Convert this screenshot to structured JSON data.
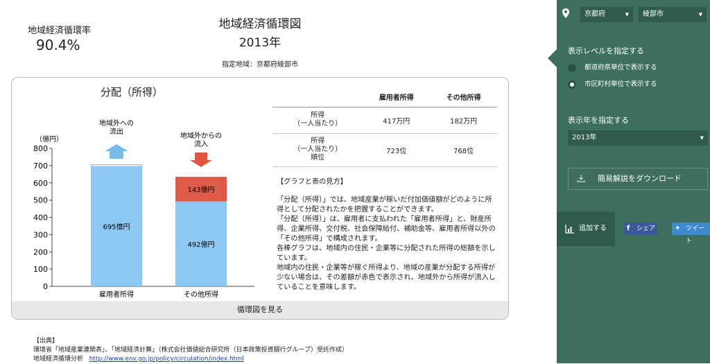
{
  "page": {
    "circulation_rate_label": "地域経済循環率",
    "circulation_rate_value": "90.4%",
    "title": "地域経済循環図",
    "year": "2013年",
    "region_label": "指定地域：京都府綾部市"
  },
  "card": {
    "chart_title": "分配（所得）",
    "footer_button": "循環図を見る"
  },
  "chart_data": {
    "type": "bar",
    "ylabel": "（億円）",
    "ylim": [
      0,
      800
    ],
    "yticks": [
      0,
      100,
      200,
      300,
      400,
      500,
      600,
      700,
      800
    ],
    "categories": [
      "雇用者所得",
      "その他所得"
    ],
    "series": [
      {
        "name": "",
        "values": [
          695,
          492
        ],
        "labels": [
          "695億円",
          "492億円"
        ],
        "color": "#8dc8f5"
      },
      {
        "name": "",
        "values": [
          0,
          143
        ],
        "labels": [
          "",
          "143億円"
        ],
        "color": "#de5b49"
      }
    ],
    "outflow_cap": 705,
    "annotations": {
      "outflow": [
        "地域外への",
        "流出"
      ],
      "inflow": [
        "地域外からの",
        "流入"
      ],
      "outflow_color": "#78bbe8",
      "inflow_color": "#e2563f"
    }
  },
  "table": {
    "headers": [
      "",
      "雇用者所得",
      "その他所得"
    ],
    "rows": [
      {
        "label": [
          "所得",
          "（一人当たり）"
        ],
        "values": [
          "417万円",
          "182万円"
        ]
      },
      {
        "label": [
          "所得",
          "（一人当たり）",
          "順位"
        ],
        "values": [
          "723位",
          "768位"
        ]
      }
    ]
  },
  "explanation": {
    "heading": "【グラフと表の見方】",
    "paragraphs": [
      "「分配（所得）」では、地域産業が稼いだ付加価値額がどのように所得として分配されたかを把握することができます。",
      "「分配（所得）」は、雇用者に支払われた「雇用者所得」と、財産所得、企業所得、交付税、社会保障給付、補助金等、雇用者所得以外の「その他所得」で構成されます。",
      "各棒グラフは、地域内の住民・企業等に分配された所得の総額を示しています。",
      "地域内の住民・企業等が稼ぐ所得より、地域の産業が分配する所得が少ない場合は、その差額が赤色で表示され、地域外から所得が流入していることを意味します。"
    ]
  },
  "source": {
    "heading": "【出典】",
    "line1": "環境省「地域産業連関表」、「地域経済計算」（株式会社価値総合研究所（日本政策投資銀行グループ）受託作成）",
    "line2_label": "地域経済循環分析",
    "line2_link": "http://www.env.go.jp/policy/circulation/index.html"
  },
  "sidebar": {
    "prefecture": "京都府",
    "city": "綾部市",
    "level_label": "表示レベルを指定する",
    "level_options": [
      "都道府県単位で表示する",
      "市区町村単位で表示する"
    ],
    "level_selected": 1,
    "year_label": "表示年を指定する",
    "year_value": "2013年",
    "download_label": "簡易解説をダウンロード",
    "add_label": "追加する",
    "facebook_label": "シェア",
    "twitter_label": "ツイート",
    "colors": {
      "bg": "#3d6e5e",
      "select_bg": "#2f5a4c"
    },
    "icons": [
      "location-pin-icon",
      "download-icon",
      "chart-add-icon",
      "facebook-icon",
      "twitter-icon"
    ]
  }
}
